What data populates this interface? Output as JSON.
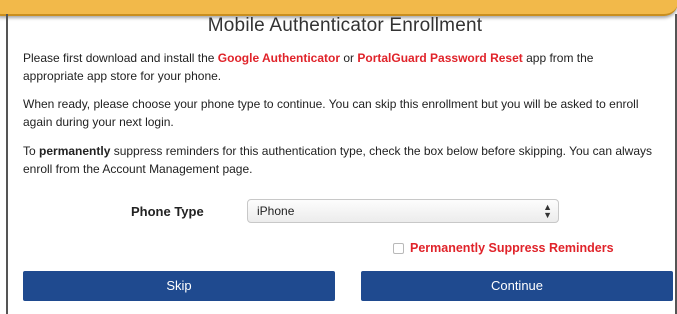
{
  "dialog": {
    "title": "Mobile Authenticator Enrollment",
    "para1": {
      "pre": "Please first download and install the ",
      "link1": "Google Authenticator",
      "mid": " or ",
      "link2": "PortalGuard Password Reset",
      "post": " app from the appropriate app store for your phone."
    },
    "para2": "When ready, please choose your phone type to continue. You can skip this enrollment but you will be asked to enroll again during your next login.",
    "para3": {
      "pre": "To ",
      "strong": "permanently",
      "post": " suppress reminders for this authentication type, check the box below before skipping. You can always enroll from the Account Management page."
    },
    "phone_type_label": "Phone Type",
    "phone_type_value": "iPhone",
    "suppress_label": "Permanently Suppress Reminders",
    "suppress_checked": false,
    "skip_label": "Skip",
    "continue_label": "Continue"
  },
  "colors": {
    "banner": "#f2b94a",
    "link_red": "#e0232a",
    "button_blue": "#1f4a8f"
  }
}
